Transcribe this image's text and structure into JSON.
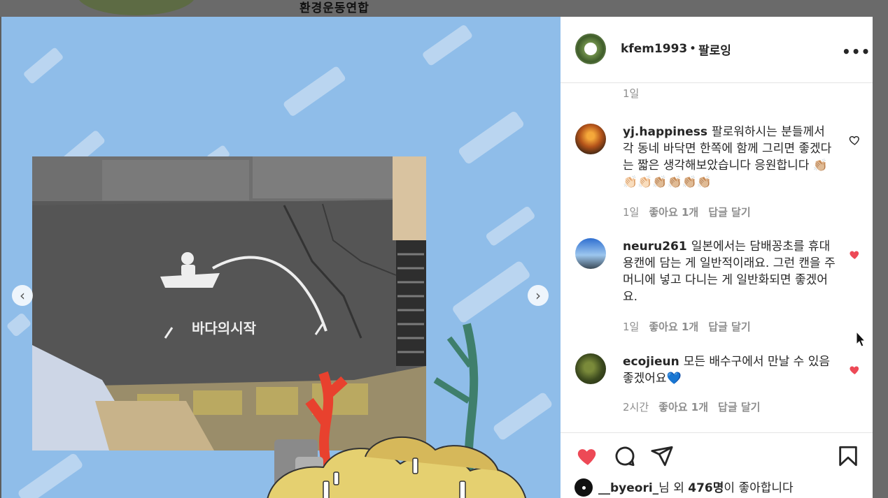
{
  "background": {
    "org_name": "환경운동연합"
  },
  "post": {
    "account": "kfem1993",
    "separator": "•",
    "follow_label": "팔로잉",
    "more_label": "•••",
    "media": {
      "stencil_text": "바다의시작",
      "prev_label": "‹",
      "next_label": "›"
    }
  },
  "comments": {
    "previous_time": "1일",
    "items": [
      {
        "username": "yj.happiness",
        "text": "팔로워하시는 분들께서 각 동네 바닥면 한쪽에 함께 그리면 좋겠다는 짧은 생각해보았습니다 응원합니다 👏🏼👏🏻👏🏻👏🏼👏🏼👏🏼👏🏼",
        "time": "1일",
        "likes": "좋아요 1개",
        "reply": "답글 달기",
        "liked": false
      },
      {
        "username": "neuru261",
        "text": "일본에서는 담배꽁초를 휴대용캔에 담는 게 일반적이래요. 그런 캔을 주머니에 넣고 다니는 게 일반화되면 좋겠어요.",
        "time": "1일",
        "likes": "좋아요 1개",
        "reply": "답글 달기",
        "liked": true
      },
      {
        "username": "ecojieun",
        "text": "모든 배수구에서 만날 수 있음 좋겠어요💙",
        "time": "2시간",
        "likes": "좋아요 1개",
        "reply": "답글 달기",
        "liked": true
      }
    ]
  },
  "likes": {
    "first_user": "__byeori_",
    "text_mid": "님 외 ",
    "count": "476명",
    "text_end": "이 좋아합니다"
  },
  "colors": {
    "accent_red": "#ed4956",
    "media_bg": "#8fbde9",
    "muted": "#8e8e8e"
  },
  "icons": [
    "heart-icon",
    "comment-icon",
    "share-icon",
    "bookmark-icon",
    "more-icon"
  ]
}
